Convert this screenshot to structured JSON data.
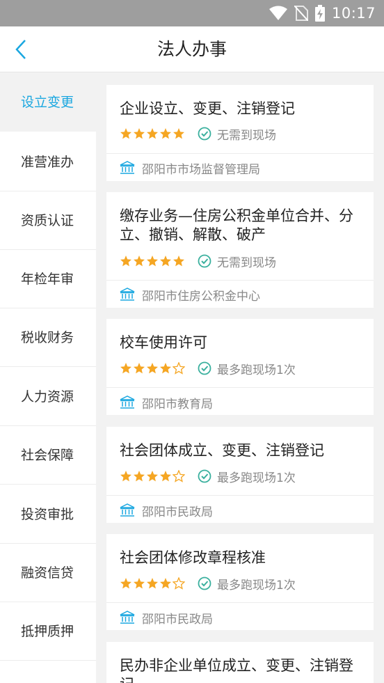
{
  "status": {
    "time": "10:17"
  },
  "header": {
    "title": "法人办事"
  },
  "sidebar": {
    "items": [
      {
        "label": "设立变更",
        "active": true
      },
      {
        "label": "准营准办",
        "active": false
      },
      {
        "label": "资质认证",
        "active": false
      },
      {
        "label": "年检年审",
        "active": false
      },
      {
        "label": "税收财务",
        "active": false
      },
      {
        "label": "人力资源",
        "active": false
      },
      {
        "label": "社会保障",
        "active": false
      },
      {
        "label": "投资审批",
        "active": false
      },
      {
        "label": "融资信贷",
        "active": false
      },
      {
        "label": "抵押质押",
        "active": false
      }
    ]
  },
  "services": [
    {
      "name": "企业设立、变更、注销登记",
      "rating": 5,
      "visit": "无需到现场",
      "dept": "邵阳市市场监督管理局"
    },
    {
      "name": "缴存业务—住房公积金单位合并、分立、撤销、解散、破产",
      "rating": 5,
      "visit": "无需到现场",
      "dept": "邵阳市住房公积金中心"
    },
    {
      "name": "校车使用许可",
      "rating": 4,
      "visit": "最多跑现场1次",
      "dept": "邵阳市教育局"
    },
    {
      "name": "社会团体成立、变更、注销登记",
      "rating": 4,
      "visit": "最多跑现场1次",
      "dept": "邵阳市民政局"
    },
    {
      "name": "社会团体修改章程核准",
      "rating": 4,
      "visit": "最多跑现场1次",
      "dept": "邵阳市民政局"
    },
    {
      "name": "民办非企业单位成立、变更、注销登记",
      "rating": null,
      "visit": "",
      "dept": ""
    }
  ],
  "colors": {
    "accent": "#1aa7e0",
    "star": "#f5a623",
    "check": "#3ab09e"
  }
}
